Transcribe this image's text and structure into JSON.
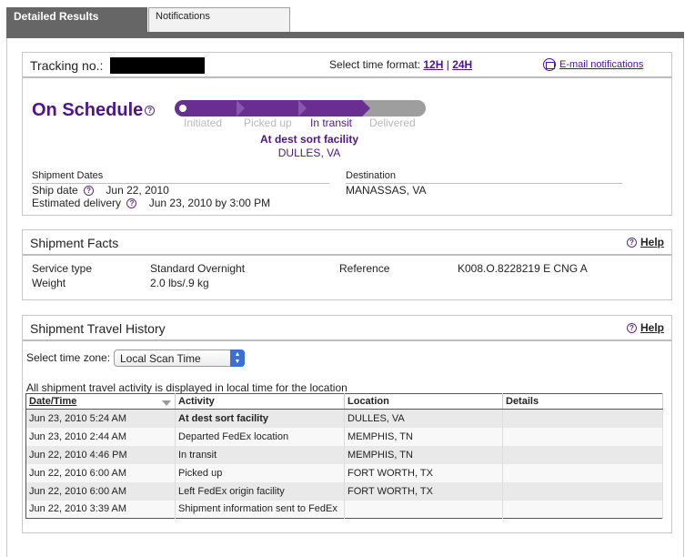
{
  "tabs": {
    "active": "Detailed Results",
    "inactive": "Notifications"
  },
  "tracking": {
    "label": "Tracking no.:",
    "time_format_label": "Select time format:",
    "format_12h": "12H",
    "format_sep": "|",
    "format_24h": "24H",
    "email_notifications": "E-mail notifications",
    "status": "On Schedule",
    "steps": [
      "Initiated",
      "Picked up",
      "In transit",
      "Delivered"
    ],
    "current_step": 3,
    "current_activity": "At dest sort facility",
    "current_location": "DULLES, VA",
    "shipment_dates_label": "Shipment Dates",
    "ship_date_label": "Ship date",
    "ship_date": "Jun 22, 2010",
    "est_delivery_label": "Estimated delivery",
    "est_delivery": "Jun 23, 2010 by 3:00 PM",
    "destination_label": "Destination",
    "destination": "MANASSAS, VA"
  },
  "facts": {
    "title": "Shipment Facts",
    "help": "Help",
    "service_type_label": "Service type",
    "service_type": "Standard Overnight",
    "weight_label": "Weight",
    "weight": "2.0 lbs/.9 kg",
    "reference_label": "Reference",
    "reference": "K008.O.8228219 E CNG A"
  },
  "history": {
    "title": "Shipment Travel History",
    "help": "Help",
    "timezone_label": "Select time zone:",
    "timezone_value": "Local Scan Time",
    "note": "All shipment travel activity is displayed in local time for the location",
    "columns": [
      "Date/Time",
      "Activity",
      "Location",
      "Details"
    ],
    "rows": [
      {
        "datetime": "Jun 23, 2010 5:24 AM",
        "activity": "At dest sort facility",
        "location": "DULLES, VA",
        "details": "",
        "bold": true
      },
      {
        "datetime": "Jun 23, 2010 2:44 AM",
        "activity": "Departed FedEx location",
        "location": "MEMPHIS, TN",
        "details": ""
      },
      {
        "datetime": "Jun 22, 2010 4:46 PM",
        "activity": "In transit",
        "location": "MEMPHIS, TN",
        "details": ""
      },
      {
        "datetime": "Jun 22, 2010 6:00 AM",
        "activity": "Picked up",
        "location": "FORT WORTH, TX",
        "details": ""
      },
      {
        "datetime": "Jun 22, 2010 6:00 AM",
        "activity": "Left FedEx origin facility",
        "location": "FORT WORTH, TX",
        "details": ""
      },
      {
        "datetime": "Jun 22, 2010 3:39 AM",
        "activity": "Shipment information sent to FedEx",
        "location": "",
        "details": ""
      }
    ]
  },
  "colors": {
    "brand_purple": "#4d148c",
    "progress_done": "#6a2d91",
    "progress_todo": "#9e9e9e",
    "tab_active": "#666666"
  }
}
